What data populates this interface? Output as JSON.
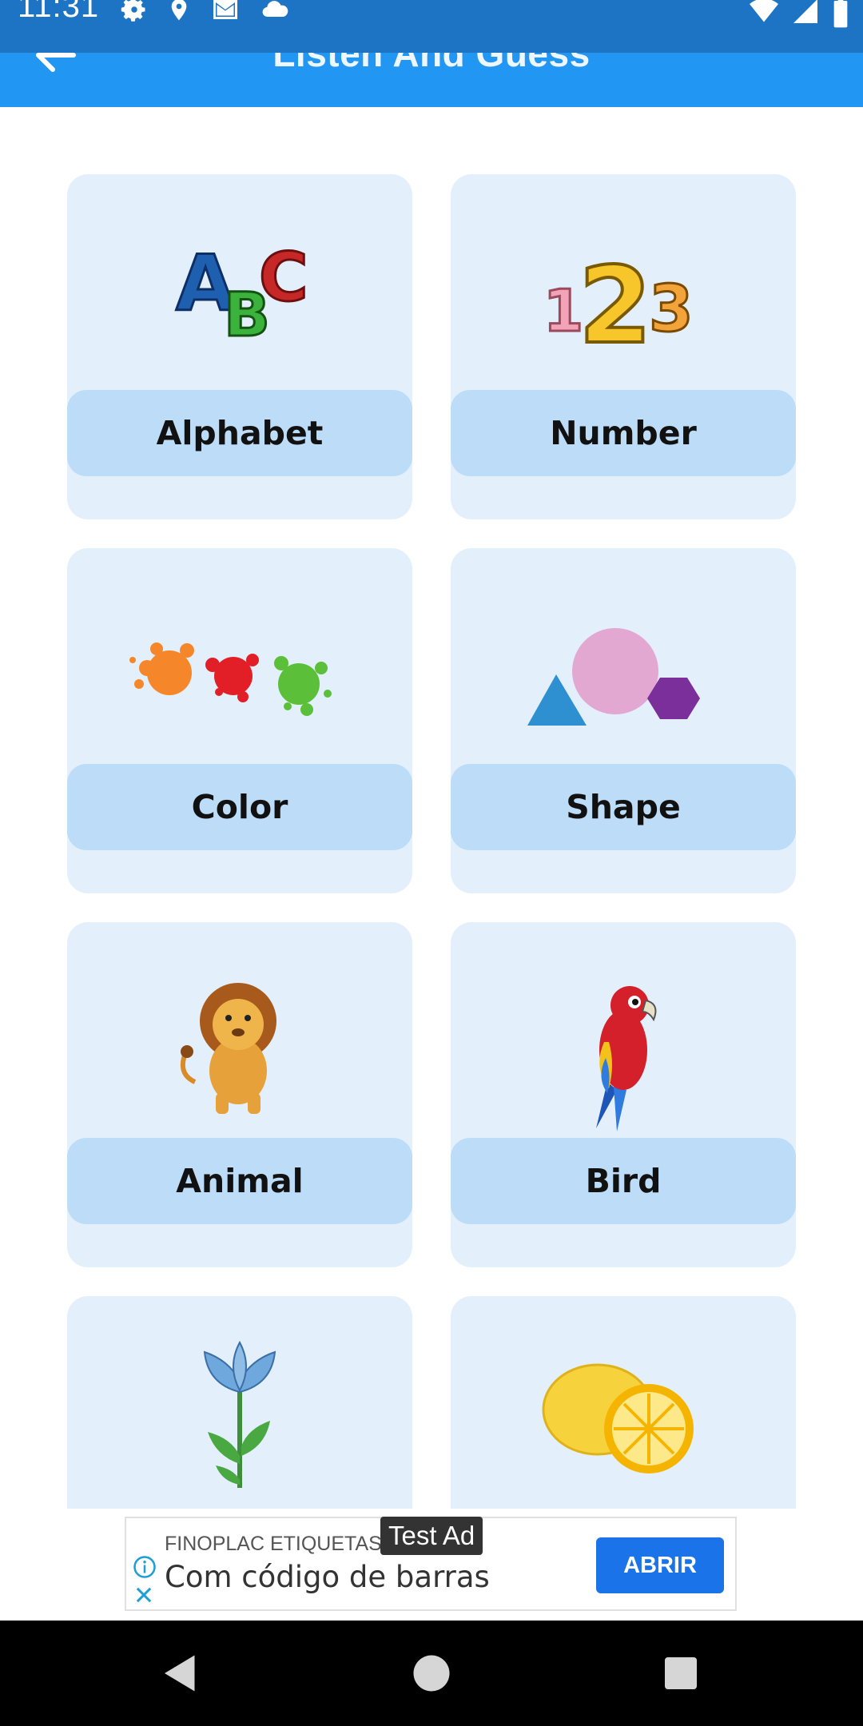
{
  "status_bar": {
    "time": "11:31",
    "left_icons": [
      "gear-icon",
      "location-icon",
      "gmail-icon",
      "cloud-icon"
    ],
    "right_icons": [
      "wifi-icon",
      "signal-icon",
      "battery-icon"
    ]
  },
  "app_bar": {
    "title": "Listen And Guess",
    "back_icon": "arrow-back-icon",
    "color": "#2196f3"
  },
  "categories": [
    {
      "label": "Alphabet",
      "icon": "abc-letters-icon"
    },
    {
      "label": "Number",
      "icon": "numbers-123-icon"
    },
    {
      "label": "Color",
      "icon": "paint-splash-icon"
    },
    {
      "label": "Shape",
      "icon": "shapes-icon"
    },
    {
      "label": "Animal",
      "icon": "lion-icon"
    },
    {
      "label": "Bird",
      "icon": "parrot-icon"
    },
    {
      "label": "",
      "icon": "flower-icon"
    },
    {
      "label": "",
      "icon": "lemon-icon"
    }
  ],
  "ad": {
    "advertiser": "FINOPLAC ETIQUETAS",
    "tag": "Test Ad",
    "headline": "Com código de barras",
    "cta": "ABRIR"
  },
  "nav_bar": {
    "buttons": [
      "back-triangle-icon",
      "home-circle-icon",
      "recents-square-icon"
    ]
  }
}
